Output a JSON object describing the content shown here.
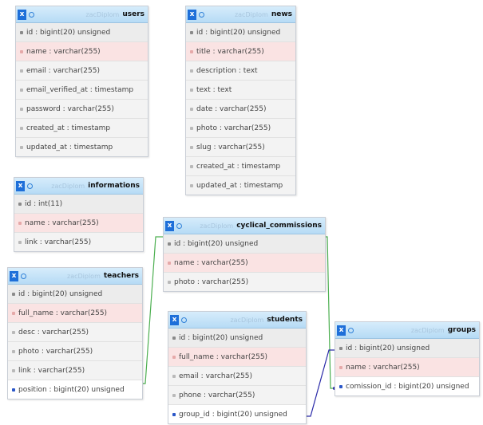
{
  "tables": [
    {
      "id": "users",
      "db": "zacDiplom",
      "name": "users",
      "fields": [
        {
          "label": "id : bigint(20) unsigned",
          "kind": "pk"
        },
        {
          "label": "name : varchar(255)",
          "kind": "hl"
        },
        {
          "label": "email : varchar(255)",
          "kind": "n"
        },
        {
          "label": "email_verified_at : timestamp",
          "kind": "n"
        },
        {
          "label": "password : varchar(255)",
          "kind": "n"
        },
        {
          "label": "created_at : timestamp",
          "kind": "n"
        },
        {
          "label": "updated_at : timestamp",
          "kind": "n"
        }
      ]
    },
    {
      "id": "news",
      "db": "zacDiplom",
      "name": "news",
      "fields": [
        {
          "label": "id : bigint(20) unsigned",
          "kind": "pk"
        },
        {
          "label": "title : varchar(255)",
          "kind": "hl"
        },
        {
          "label": "description : text",
          "kind": "n"
        },
        {
          "label": "text : text",
          "kind": "n"
        },
        {
          "label": "date : varchar(255)",
          "kind": "n"
        },
        {
          "label": "photo : varchar(255)",
          "kind": "n"
        },
        {
          "label": "slug : varchar(255)",
          "kind": "n"
        },
        {
          "label": "created_at : timestamp",
          "kind": "n"
        },
        {
          "label": "updated_at : timestamp",
          "kind": "n"
        }
      ]
    },
    {
      "id": "informations",
      "db": "zacDiplom",
      "name": "informations",
      "fields": [
        {
          "label": "id : int(11)",
          "kind": "pk"
        },
        {
          "label": "name : varchar(255)",
          "kind": "hl"
        },
        {
          "label": "link : varchar(255)",
          "kind": "n"
        }
      ]
    },
    {
      "id": "cyclical_commissions",
      "db": "zacDiplom",
      "name": "cyclical_commissions",
      "fields": [
        {
          "label": "id : bigint(20) unsigned",
          "kind": "pk"
        },
        {
          "label": "name : varchar(255)",
          "kind": "hl"
        },
        {
          "label": "photo : varchar(255)",
          "kind": "n"
        }
      ]
    },
    {
      "id": "teachers",
      "db": "zacDiplom",
      "name": "teachers",
      "fields": [
        {
          "label": "id : bigint(20) unsigned",
          "kind": "pk"
        },
        {
          "label": "full_name : varchar(255)",
          "kind": "hl"
        },
        {
          "label": "desc : varchar(255)",
          "kind": "n"
        },
        {
          "label": "photo : varchar(255)",
          "kind": "n"
        },
        {
          "label": "link : varchar(255)",
          "kind": "n"
        },
        {
          "label": "position : bigint(20) unsigned",
          "kind": "fk"
        }
      ]
    },
    {
      "id": "students",
      "db": "zacDiplom",
      "name": "students",
      "fields": [
        {
          "label": "id : bigint(20) unsigned",
          "kind": "pk"
        },
        {
          "label": "full_name : varchar(255)",
          "kind": "hl"
        },
        {
          "label": "email : varchar(255)",
          "kind": "n"
        },
        {
          "label": "phone : varchar(255)",
          "kind": "n"
        },
        {
          "label": "group_id : bigint(20) unsigned",
          "kind": "fk"
        }
      ]
    },
    {
      "id": "groups",
      "db": "zacDiplom",
      "name": "groups",
      "fields": [
        {
          "label": "id : bigint(20) unsigned",
          "kind": "pk"
        },
        {
          "label": "name : varchar(255)",
          "kind": "hl"
        },
        {
          "label": "comission_id : bigint(20) unsigned",
          "kind": "fk"
        }
      ]
    }
  ],
  "relations": [
    {
      "from": "teachers.position",
      "to": "cyclical_commissions.id",
      "color": "#4caf50"
    },
    {
      "from": "groups.comission_id",
      "to": "cyclical_commissions.id",
      "color": "#4caf50"
    },
    {
      "from": "students.group_id",
      "to": "groups.id",
      "color": "#2a2aa8"
    }
  ]
}
